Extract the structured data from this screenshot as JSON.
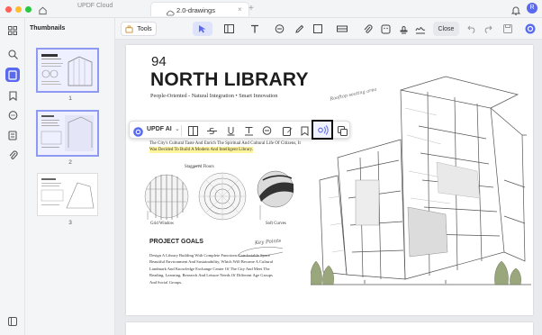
{
  "titlebar": {
    "cloud_tab": "UPDF Cloud",
    "active_tab": "2.0-drawings",
    "avatar_initial": "R"
  },
  "sidebar": {
    "thumbnails_title": "Thumbnails",
    "thumbs": [
      {
        "page": "1"
      },
      {
        "page": "2"
      },
      {
        "page": "3"
      }
    ]
  },
  "toolbar": {
    "tools_label": "Tools",
    "close_label": "Close"
  },
  "floating_toolbar": {
    "ai_label": "UPDF AI"
  },
  "document": {
    "page_number": "94",
    "heading": "NORTH LIBRARY",
    "subheading": "People-Oriented - Natural Integration • Smart Innovation",
    "body_line1": "The City's Cultural Taste And Enrich The Spiritual And Cultural Life Of Citizens, It",
    "body_line2": "Was Decided To Build A Modern And Intelligent Library.",
    "label_staggered": "Staggered Floors",
    "label_grid": "Grid Window",
    "label_soft": "Soft Curves",
    "handwritten_top": "Rooftop seating area",
    "handwritten_key": "Key Points",
    "project_goals_title": "PROJECT GOALS",
    "goals_lines": [
      "Design A Library Building With Complete Functions Comfortable Space",
      "Beautiful Environment And Sustainability, Which Will Become A Cultural",
      "Landmark And Knowledge Exchange Center Of The City And Meet The",
      "Reading, Learning, Research And Leisure Needs Of Different Age Groups",
      "And Social Groups."
    ]
  },
  "colors": {
    "accent": "#5a6aee",
    "highlight": "#fff59d"
  }
}
